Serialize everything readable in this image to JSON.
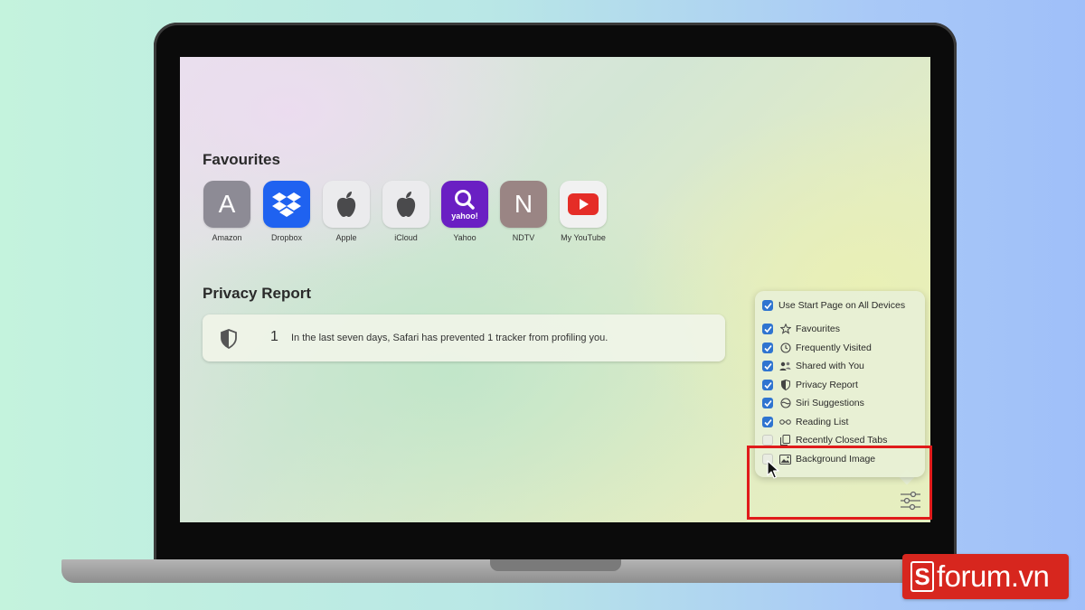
{
  "favourites": {
    "title": "Favourites",
    "items": [
      {
        "label": "Amazon",
        "letter": "A",
        "bg": "#8d8b95",
        "icon": "letter-tile-icon"
      },
      {
        "label": "Dropbox",
        "bg": "#1f62f0",
        "icon": "dropbox-icon"
      },
      {
        "label": "Apple",
        "bg": "#ebebed",
        "icon": "apple-icon"
      },
      {
        "label": "iCloud",
        "bg": "#ebebed",
        "icon": "apple-icon"
      },
      {
        "label": "Yahoo",
        "bg": "#6a1fc3",
        "icon": "yahoo-icon",
        "wordmark": "yahoo!"
      },
      {
        "label": "NDTV",
        "letter": "N",
        "bg": "#9a8584",
        "icon": "letter-tile-icon"
      },
      {
        "label": "My YouTube",
        "bg": "#f1f1f1",
        "icon": "youtube-icon"
      }
    ]
  },
  "privacy": {
    "title": "Privacy Report",
    "count": "1",
    "text": "In the last seven days, Safari has prevented 1 tracker from profiling you.",
    "icon": "shield-icon"
  },
  "options": {
    "header": {
      "label": "Use Start Page on All Devices",
      "checked": true
    },
    "items": [
      {
        "label": "Favourites",
        "checked": true,
        "icon": "star-icon"
      },
      {
        "label": "Frequently Visited",
        "checked": true,
        "icon": "clock-icon"
      },
      {
        "label": "Shared with You",
        "checked": true,
        "icon": "people-icon"
      },
      {
        "label": "Privacy Report",
        "checked": true,
        "icon": "shield-icon"
      },
      {
        "label": "Siri Suggestions",
        "checked": true,
        "icon": "siri-icon"
      },
      {
        "label": "Reading List",
        "checked": true,
        "icon": "glasses-icon"
      },
      {
        "label": "Recently Closed Tabs",
        "checked": false,
        "icon": "tabs-icon"
      },
      {
        "label": "Background Image",
        "checked": false,
        "icon": "image-icon"
      }
    ]
  },
  "colors": {
    "accent": "#2f74d0",
    "highlight": "#e01b1b",
    "brand_red": "#d7261e"
  },
  "watermark": {
    "brand": "S",
    "text": "forum.vn"
  }
}
